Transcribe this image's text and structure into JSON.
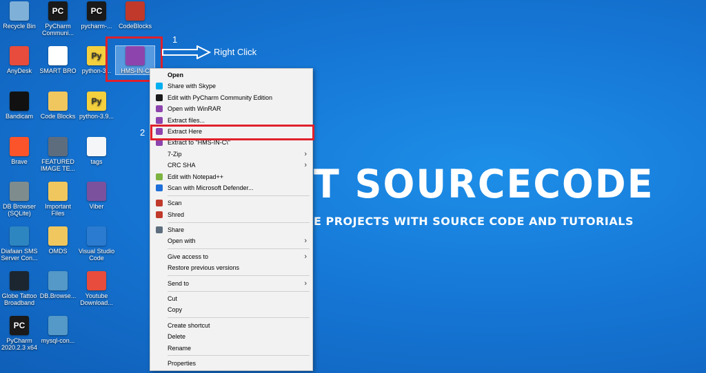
{
  "wallpaper": {
    "title": "T SOURCECODE",
    "subtitle": "E PROJECTS WITH SOURCE CODE AND TUTORIALS"
  },
  "desktop": {
    "icons": [
      {
        "label": "Recycle Bin",
        "icon": "recycle-bin-icon",
        "color": "#7fb0d8"
      },
      {
        "label": "PyCharm Communi...",
        "icon": "pycharm-icon",
        "color": "#1a1a1a"
      },
      {
        "label": "pycharm-...",
        "icon": "pycharm-icon",
        "color": "#1a1a1a"
      },
      {
        "label": "CodeBlocks",
        "icon": "codeblocks-icon",
        "color": "#c0392b"
      },
      {
        "label": "AnyDesk",
        "icon": "anydesk-icon",
        "color": "#e74c3c"
      },
      {
        "label": "SMART BRO",
        "icon": "smart-bro-icon",
        "color": "#ffffff"
      },
      {
        "label": "python-3...",
        "icon": "python-icon",
        "color": "#f4d03f"
      },
      {
        "label": "HMS-IN-C",
        "icon": "winrar-archive-icon",
        "color": "#8e44ad"
      },
      {
        "label": "Bandicam",
        "icon": "bandicam-icon",
        "color": "#111111"
      },
      {
        "label": "Code Blocks",
        "icon": "folder-icon",
        "color": "#f0c75e"
      },
      {
        "label": "python-3.9...",
        "icon": "python-icon",
        "color": "#f4d03f"
      },
      {
        "label": "Brave",
        "icon": "brave-icon",
        "color": "#fb542b"
      },
      {
        "label": "FEATURED IMAGE TE...",
        "icon": "file-icon",
        "color": "#5d6d7e"
      },
      {
        "label": "tags",
        "icon": "document-icon",
        "color": "#f4f6f7"
      },
      {
        "label": "DB Browser (SQLite)",
        "icon": "db-browser-icon",
        "color": "#7f8c8d"
      },
      {
        "label": "Important Files",
        "icon": "folder-icon",
        "color": "#f0c75e"
      },
      {
        "label": "Viber",
        "icon": "viber-icon",
        "color": "#7b519d"
      },
      {
        "label": "Diafaan SMS Server Con...",
        "icon": "diafaan-icon",
        "color": "#2e86c1"
      },
      {
        "label": "OMDS",
        "icon": "folder-icon",
        "color": "#f0c75e"
      },
      {
        "label": "Visual Studio Code",
        "icon": "vscode-icon",
        "color": "#2b7bd0"
      },
      {
        "label": "Globe Tattoo Broadband",
        "icon": "globe-tattoo-icon",
        "color": "#1b2631"
      },
      {
        "label": "DB.Browse...",
        "icon": "installer-icon",
        "color": "#5499c7"
      },
      {
        "label": "Youtube Download...",
        "icon": "youtube-downloader-icon",
        "color": "#e74c3c"
      },
      {
        "label": "PyCharm 2020.2.3 x64",
        "icon": "pycharm-icon",
        "color": "#1a1a1a"
      },
      {
        "label": "mysql-con...",
        "icon": "installer-icon",
        "color": "#5499c7"
      }
    ]
  },
  "annotations": {
    "step1": "1",
    "step1_text": "Right Click",
    "step2": "2"
  },
  "context_menu": {
    "items": [
      {
        "label": "Open",
        "bold": true
      },
      {
        "label": "Share with Skype",
        "icon": "skype-icon",
        "color": "#00aff0"
      },
      {
        "label": "Edit with PyCharm Community Edition",
        "icon": "pycharm-icon",
        "color": "#1a1a1a"
      },
      {
        "label": "Open with WinRAR",
        "icon": "winrar-icon",
        "color": "#8e44ad"
      },
      {
        "label": "Extract files...",
        "icon": "winrar-icon",
        "color": "#8e44ad"
      },
      {
        "label": "Extract Here",
        "icon": "winrar-icon",
        "color": "#8e44ad"
      },
      {
        "label": "Extract to \"HMS-IN-C\\\"",
        "icon": "winrar-icon",
        "color": "#8e44ad"
      },
      {
        "label": "7-Zip",
        "submenu": true
      },
      {
        "label": "CRC SHA",
        "submenu": true
      },
      {
        "label": "Edit with Notepad++",
        "icon": "notepad-plus-icon",
        "color": "#7cb342"
      },
      {
        "label": "Scan with Microsoft Defender...",
        "icon": "defender-icon",
        "color": "#1e6fd9"
      },
      {
        "sep": true
      },
      {
        "label": "Scan",
        "icon": "mcafee-icon",
        "color": "#c0392b"
      },
      {
        "label": "Shred",
        "icon": "mcafee-icon",
        "color": "#c0392b"
      },
      {
        "sep": true
      },
      {
        "label": "Share",
        "icon": "share-icon",
        "color": "#5d6d7e"
      },
      {
        "label": "Open with",
        "submenu": true
      },
      {
        "sep": true
      },
      {
        "label": "Give access to",
        "submenu": true
      },
      {
        "label": "Restore previous versions"
      },
      {
        "sep": true
      },
      {
        "label": "Send to",
        "submenu": true
      },
      {
        "sep": true
      },
      {
        "label": "Cut"
      },
      {
        "label": "Copy"
      },
      {
        "sep": true
      },
      {
        "label": "Create shortcut"
      },
      {
        "label": "Delete"
      },
      {
        "label": "Rename"
      },
      {
        "sep": true
      },
      {
        "label": "Properties"
      }
    ]
  }
}
